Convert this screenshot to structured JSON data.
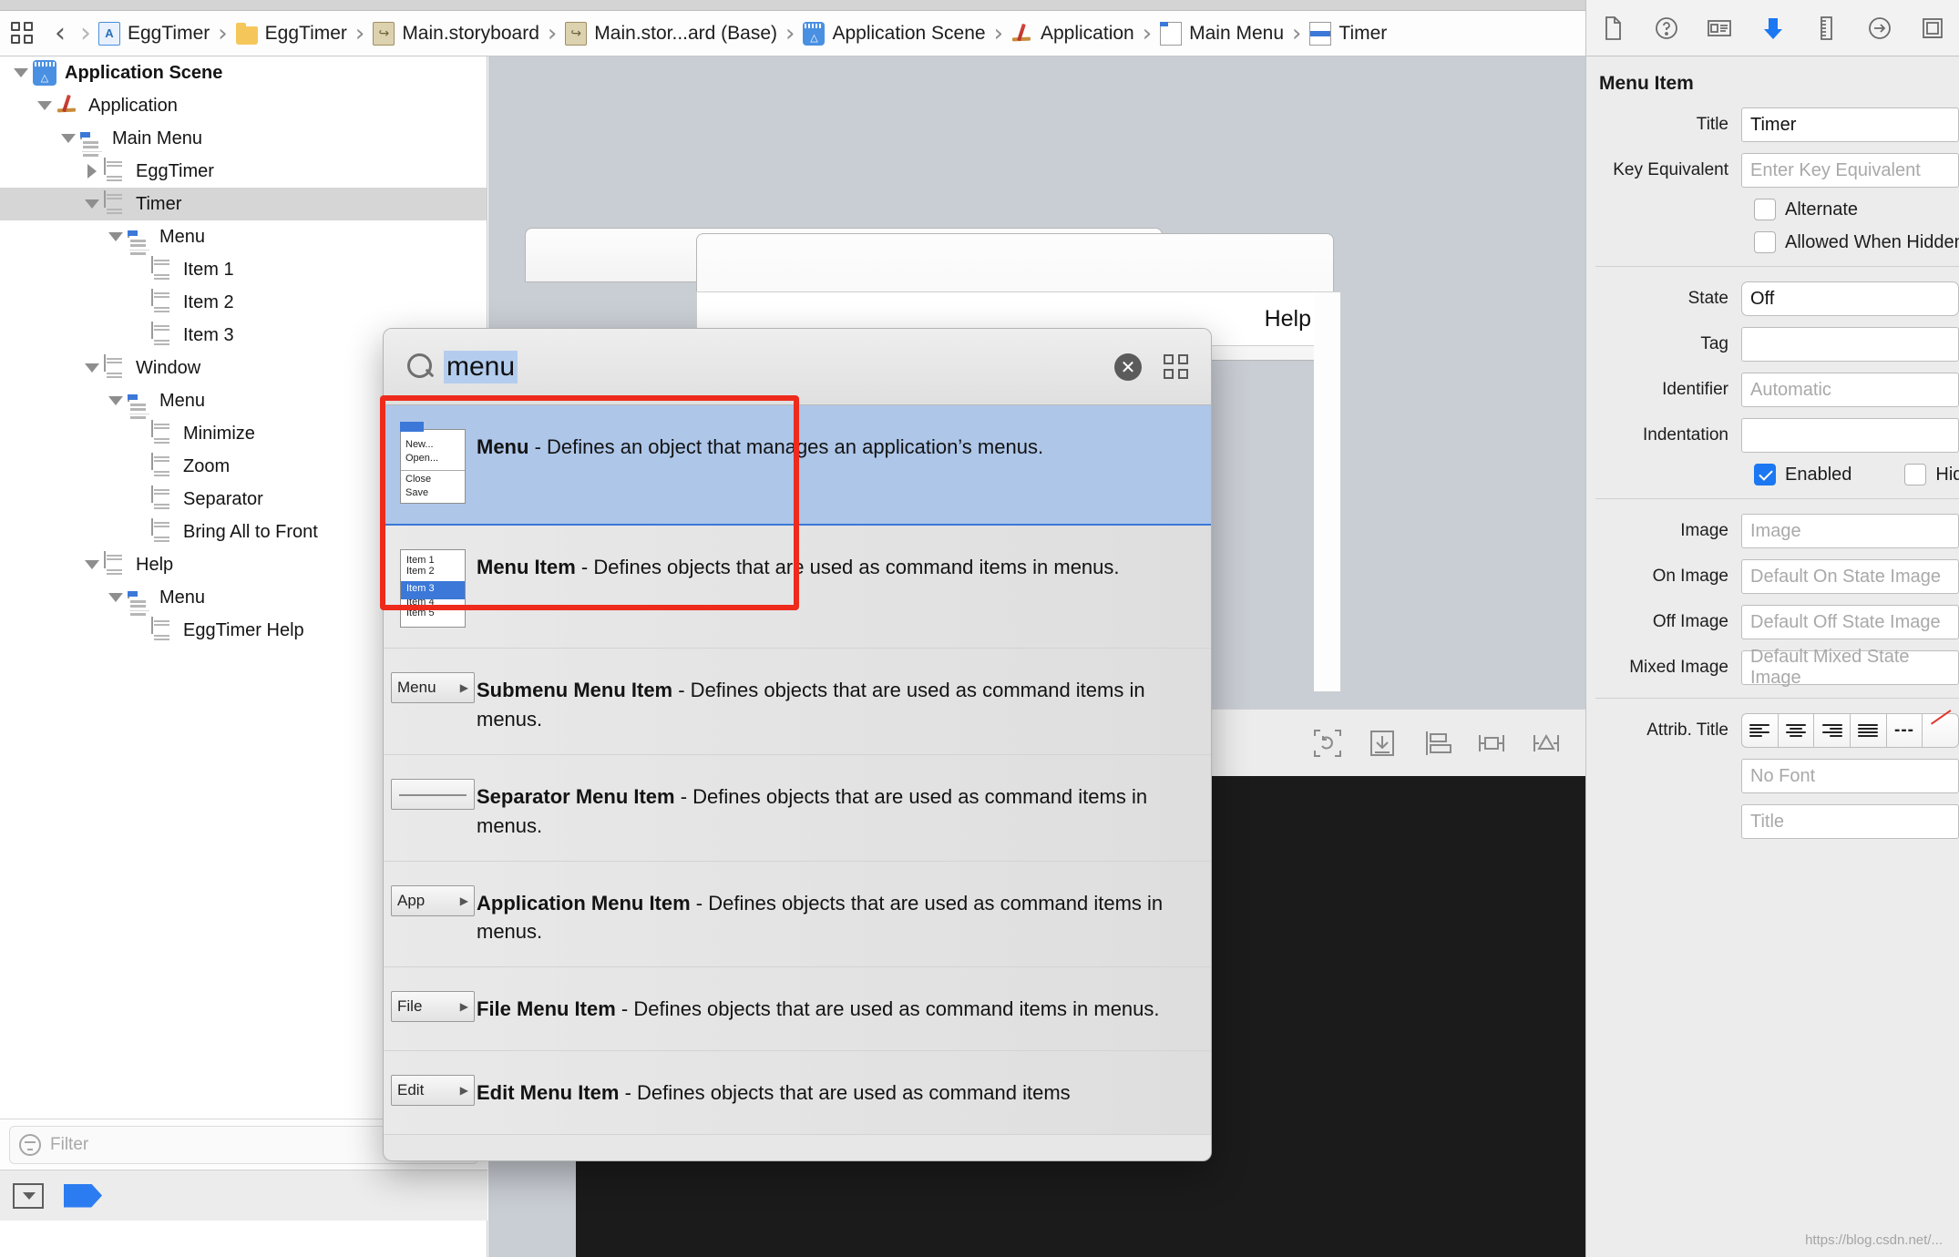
{
  "breadcrumb": {
    "grid_icon": "grid-icon",
    "back_label": "‹",
    "forward_label": "›",
    "items": [
      {
        "label": "EggTimer",
        "icon": "project-icon"
      },
      {
        "label": "EggTimer",
        "icon": "folder-icon"
      },
      {
        "label": "Main.storyboard",
        "icon": "storyboard-file-icon"
      },
      {
        "label": "Main.stor...ard (Base)",
        "icon": "storyboard-file-icon"
      },
      {
        "label": "Application Scene",
        "icon": "scene-icon"
      },
      {
        "label": "Application",
        "icon": "application-icon"
      },
      {
        "label": "Main Menu",
        "icon": "menu-icon"
      },
      {
        "label": "Timer",
        "icon": "menu-item-icon"
      }
    ],
    "separator": "›"
  },
  "navigator": {
    "tree": [
      {
        "label": "Application Scene",
        "depth": 0,
        "twisty": "open",
        "icon": "scene-icon",
        "bold": true,
        "selected": false
      },
      {
        "label": "Application",
        "depth": 1,
        "twisty": "open",
        "icon": "application-icon",
        "bold": false,
        "selected": false
      },
      {
        "label": "Main Menu",
        "depth": 2,
        "twisty": "open",
        "icon": "menu-icon",
        "bold": false,
        "selected": false
      },
      {
        "label": "EggTimer",
        "depth": 3,
        "twisty": "closed",
        "icon": "menu-item-icon",
        "bold": false,
        "selected": false
      },
      {
        "label": "Timer",
        "depth": 3,
        "twisty": "open",
        "icon": "menu-item-icon",
        "bold": false,
        "selected": true
      },
      {
        "label": "Menu",
        "depth": 4,
        "twisty": "open",
        "icon": "menu-icon",
        "bold": false,
        "selected": false
      },
      {
        "label": "Item 1",
        "depth": 5,
        "twisty": "none",
        "icon": "menu-item-icon",
        "bold": false,
        "selected": false
      },
      {
        "label": "Item 2",
        "depth": 5,
        "twisty": "none",
        "icon": "menu-item-icon",
        "bold": false,
        "selected": false
      },
      {
        "label": "Item 3",
        "depth": 5,
        "twisty": "none",
        "icon": "menu-item-icon",
        "bold": false,
        "selected": false
      },
      {
        "label": "Window",
        "depth": 3,
        "twisty": "open",
        "icon": "menu-item-icon",
        "bold": false,
        "selected": false
      },
      {
        "label": "Menu",
        "depth": 4,
        "twisty": "open",
        "icon": "menu-icon",
        "bold": false,
        "selected": false
      },
      {
        "label": "Minimize",
        "depth": 5,
        "twisty": "none",
        "icon": "menu-item-icon",
        "bold": false,
        "selected": false
      },
      {
        "label": "Zoom",
        "depth": 5,
        "twisty": "none",
        "icon": "menu-item-icon",
        "bold": false,
        "selected": false
      },
      {
        "label": "Separator",
        "depth": 5,
        "twisty": "none",
        "icon": "menu-item-icon",
        "bold": false,
        "selected": false
      },
      {
        "label": "Bring All to Front",
        "depth": 5,
        "twisty": "none",
        "icon": "menu-item-icon",
        "bold": false,
        "selected": false
      },
      {
        "label": "Help",
        "depth": 3,
        "twisty": "open",
        "icon": "menu-item-icon",
        "bold": false,
        "selected": false
      },
      {
        "label": "Menu",
        "depth": 4,
        "twisty": "open",
        "icon": "menu-icon",
        "bold": false,
        "selected": false
      },
      {
        "label": "EggTimer Help",
        "depth": 5,
        "twisty": "none",
        "icon": "menu-item-icon",
        "bold": false,
        "selected": false
      }
    ],
    "filter_placeholder": "Filter",
    "footer": {
      "filter_button_icon": "filter-chevron-icon",
      "tag_button_icon": "tag-icon"
    }
  },
  "canvas": {
    "help_menu_label": "Help",
    "bottom_toolbar": [
      {
        "icon": "update-frames-icon"
      },
      {
        "icon": "embed-in-icon"
      },
      {
        "icon": "align-icon"
      },
      {
        "icon": "pin-icon"
      },
      {
        "icon": "resolve-issues-icon"
      }
    ]
  },
  "library": {
    "search_value": "menu",
    "clear_icon": "clear-circle-icon",
    "grid_toggle_icon": "grid-view-icon",
    "results": [
      {
        "title": "Menu",
        "description": " - Defines an object that manages an application’s menus.",
        "thumb": "menu-thumb",
        "selected": true,
        "thumb_lines": [
          "New...",
          "Open...",
          "Close",
          "Save"
        ]
      },
      {
        "title": "Menu Item",
        "description": " - Defines objects that are used as command items in menus.",
        "thumb": "menu-item-thumb",
        "selected": false,
        "thumb_lines": [
          "Item 1",
          "Item 2",
          "Item 3",
          "Item 4",
          "Item 5"
        ]
      },
      {
        "title": "Submenu Menu Item",
        "description": " - Defines objects that are used as command items in menus.",
        "thumb": "button-thumb",
        "selected": false,
        "thumb_label": "Menu"
      },
      {
        "title": "Separator Menu Item",
        "description": " - Defines objects that are used as command items in menus.",
        "thumb": "separator-thumb",
        "selected": false,
        "thumb_label": ""
      },
      {
        "title": "Application Menu Item",
        "description": " - Defines objects that are used as command items in menus.",
        "thumb": "button-thumb",
        "selected": false,
        "thumb_label": "App"
      },
      {
        "title": "File Menu Item",
        "description": " - Defines objects that are used as command items in menus.",
        "thumb": "button-thumb",
        "selected": false,
        "thumb_label": "File"
      },
      {
        "title": "Edit Menu Item",
        "description": " - Defines objects that are used as command items",
        "thumb": "button-thumb",
        "selected": false,
        "thumb_label": "Edit"
      }
    ],
    "highlight_color": "#ee2a1c"
  },
  "inspector": {
    "tabs": [
      {
        "icon": "file-inspector-icon",
        "active": false
      },
      {
        "icon": "quick-help-inspector-icon",
        "active": false
      },
      {
        "icon": "identity-inspector-icon",
        "active": false
      },
      {
        "icon": "attributes-inspector-icon",
        "active": true
      },
      {
        "icon": "size-inspector-icon",
        "active": false
      },
      {
        "icon": "connections-inspector-icon",
        "active": false
      },
      {
        "icon": "bindings-inspector-icon",
        "active": false
      }
    ],
    "title": "Menu Item",
    "fields": {
      "title_label": "Title",
      "title_value": "Timer",
      "key_equivalent_label": "Key Equivalent",
      "key_equivalent_placeholder": "Enter Key Equivalent",
      "alternate_label": "Alternate",
      "alternate_checked": false,
      "allowed_when_hidden_label": "Allowed When Hidden",
      "allowed_when_hidden_checked": false,
      "state_label": "State",
      "state_value": "Off",
      "tag_label": "Tag",
      "tag_value": "",
      "identifier_label": "Identifier",
      "identifier_placeholder": "Automatic",
      "indentation_label": "Indentation",
      "indentation_value": "",
      "enabled_label": "Enabled",
      "enabled_checked": true,
      "hidden_label": "Hidden",
      "hidden_checked": false,
      "image_label": "Image",
      "image_placeholder": "Image",
      "on_image_label": "On Image",
      "on_image_placeholder": "Default On State Image",
      "off_image_label": "Off Image",
      "off_image_placeholder": "Default Off State Image",
      "mixed_image_label": "Mixed Image",
      "mixed_image_placeholder": "Default Mixed State Image",
      "attrib_title_label": "Attrib. Title",
      "font_placeholder": "No Font",
      "attrib_title_placeholder": "Title"
    },
    "accent_color": "#1b78f2"
  },
  "watermark": "https://blog.csdn.net/..."
}
